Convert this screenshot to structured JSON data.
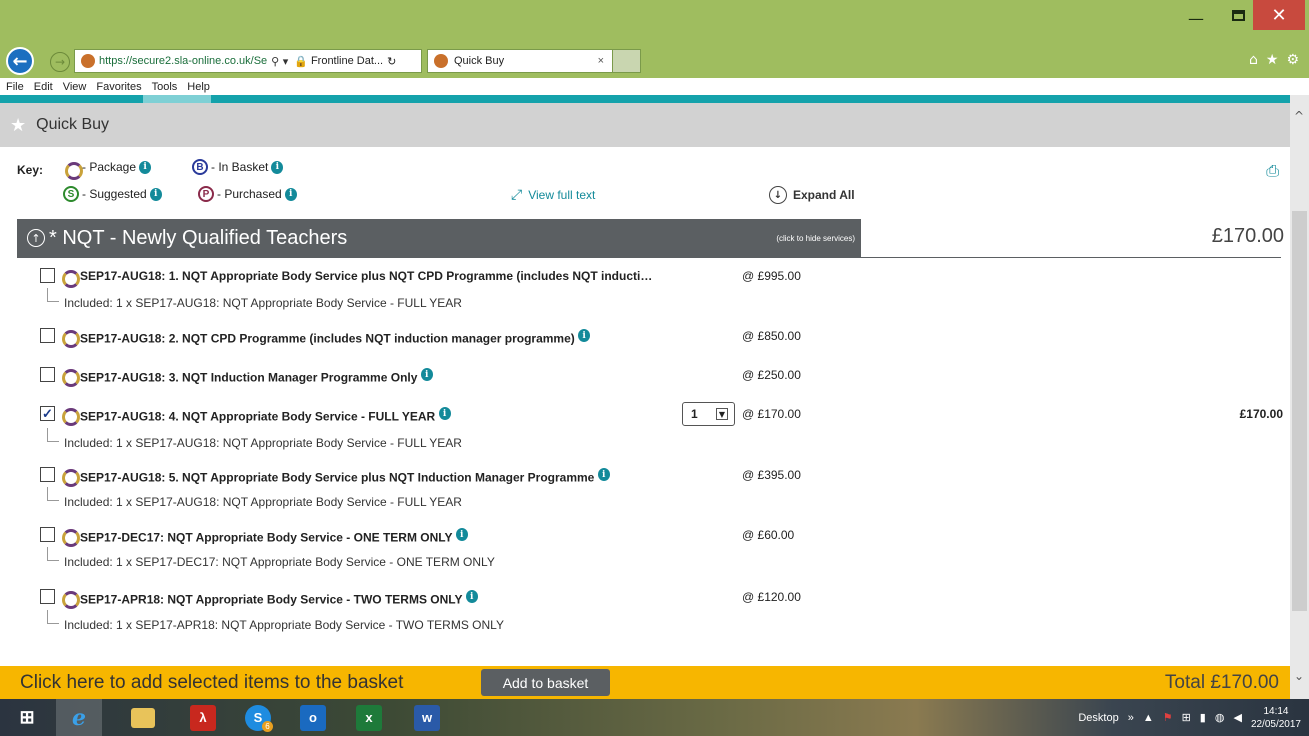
{
  "browser": {
    "url": "https://secure2.sla-online.co.uk/Se",
    "site_tab": "Frontline Dat...",
    "active_tab": "Quick Buy",
    "tab_close": "×",
    "menu": [
      "File",
      "Edit",
      "View",
      "Favorites",
      "Tools",
      "Help"
    ],
    "window_controls": {
      "minimize": "—",
      "close": "✕"
    }
  },
  "page": {
    "title": "Quick Buy",
    "key": {
      "label": "Key:",
      "package": "- Package",
      "in_basket_letter": "B",
      "in_basket": "- In Basket",
      "suggested_letter": "S",
      "suggested": "- Suggested",
      "purchased_letter": "P",
      "purchased": "- Purchased"
    },
    "view_full_text": "View full text",
    "expand_all": "Expand All"
  },
  "group": {
    "name": "* NQT - Newly Qualified Teachers",
    "hint": "(click to hide services)",
    "price": "£170.00"
  },
  "items": [
    {
      "name": "SEP17-AUG18: 1. NQT Appropriate Body Service plus NQT CPD Programme (includes NQT inducti…",
      "price": "@ £995.00",
      "checked": false,
      "info": false,
      "included": "Included: 1 x SEP17-AUG18: NQT Appropriate Body Service - FULL YEAR"
    },
    {
      "name": "SEP17-AUG18: 2. NQT CPD Programme (includes NQT induction manager programme)",
      "price": "@ £850.00",
      "checked": false,
      "info": true,
      "included": ""
    },
    {
      "name": "SEP17-AUG18: 3. NQT Induction Manager Programme Only",
      "price": "@ £250.00",
      "checked": false,
      "info": true,
      "included": ""
    },
    {
      "name": "SEP17-AUG18: 4. NQT Appropriate Body Service - FULL YEAR",
      "price": "@ £170.00",
      "checked": true,
      "info": true,
      "qty": "1",
      "line_total": "£170.00",
      "included": "Included: 1 x SEP17-AUG18: NQT Appropriate Body Service - FULL YEAR"
    },
    {
      "name": "SEP17-AUG18: 5. NQT Appropriate Body Service plus NQT Induction Manager Programme",
      "price": "@ £395.00",
      "checked": false,
      "info": true,
      "included": "Included: 1 x SEP17-AUG18: NQT Appropriate Body Service - FULL YEAR"
    },
    {
      "name": "SEP17-DEC17: NQT Appropriate Body Service - ONE TERM ONLY",
      "price": "@ £60.00",
      "checked": false,
      "info": true,
      "included": "Included: 1 x SEP17-DEC17: NQT Appropriate Body Service - ONE TERM ONLY"
    },
    {
      "name": "SEP17-APR18: NQT Appropriate Body Service - TWO TERMS ONLY",
      "price": "@ £120.00",
      "checked": false,
      "info": true,
      "included": "Included: 1 x SEP17-APR18: NQT Appropriate Body Service - TWO TERMS ONLY"
    }
  ],
  "basket_bar": {
    "message": "Click here to add selected items to the basket",
    "button": "Add to basket",
    "total": "Total £170.00"
  },
  "taskbar": {
    "desktop_label": "Desktop",
    "time": "14:14",
    "date": "22/05/2017",
    "skype_badge": "6"
  },
  "colors": {
    "titlebar": "#9fbd5f",
    "teal_accent": "#14a2ab",
    "group_header": "#5b5f62",
    "basket_bar": "#f7b600"
  }
}
